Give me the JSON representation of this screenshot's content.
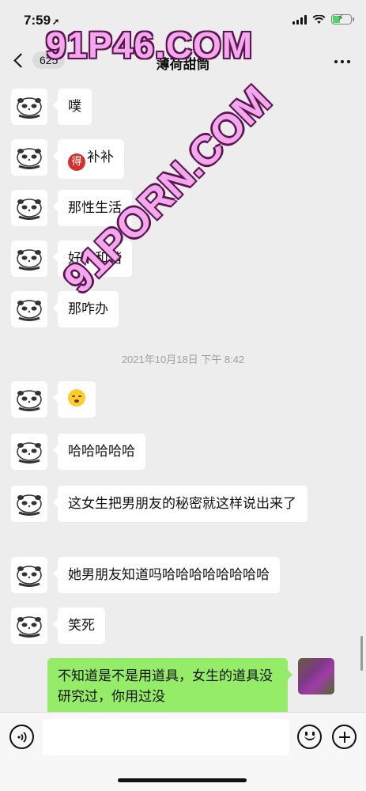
{
  "status_bar": {
    "time": "7:59",
    "location_glyph": "➚"
  },
  "nav": {
    "unread_count": "625",
    "title": "薄荷甜筒"
  },
  "messages": [
    {
      "side": "left",
      "text": "噗"
    },
    {
      "side": "left",
      "badge": "得",
      "text": "补补"
    },
    {
      "side": "left",
      "text": "那性生活"
    },
    {
      "side": "left",
      "text": "好不和谐"
    },
    {
      "side": "left",
      "text": "那咋办"
    },
    {
      "side": "left",
      "text": ""
    },
    {
      "side": "left",
      "text": "哈哈哈哈哈"
    },
    {
      "side": "left",
      "text": "这女生把男朋友的秘密就这样说出来了"
    },
    {
      "side": "left",
      "text": "她男朋友知道吗哈哈哈哈哈哈哈哈"
    },
    {
      "side": "left",
      "text": "笑死"
    },
    {
      "side": "right",
      "text": "不知道是不是用道具，女生的道具没研究过，你用过没"
    }
  ],
  "timestamp": "2021年10月18日 下午 8:42",
  "watermark": {
    "top": "91P46.COM",
    "diagonal": "91PORN.COM"
  },
  "icons": {
    "avatar": "panda-sticker-avatar",
    "emoji": "shushing-face-emoji",
    "voice": "voice-icon",
    "emoji_button": "smiley-icon",
    "plus": "plus-icon"
  },
  "colors": {
    "background": "#ededed",
    "my_bubble": "#95ec69",
    "their_bubble": "#ffffff",
    "watermark": "#f3a7ec"
  }
}
